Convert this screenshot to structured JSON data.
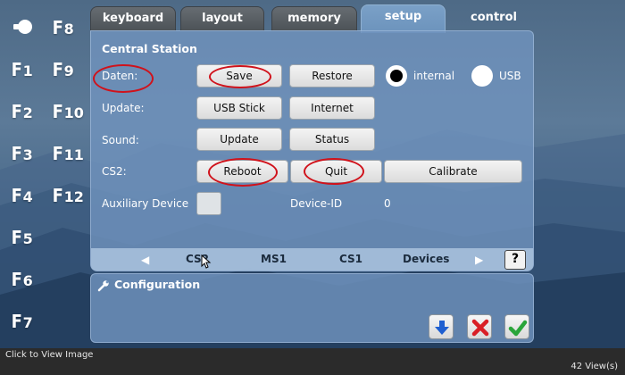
{
  "tabs": [
    {
      "label": "keyboard"
    },
    {
      "label": "layout"
    },
    {
      "label": "memory"
    },
    {
      "label": "setup",
      "active": true
    },
    {
      "label": "control"
    }
  ],
  "fkeys": [
    {
      "f": "F",
      "n": "8"
    },
    {
      "f": "F",
      "n": "1"
    },
    {
      "f": "F",
      "n": "9"
    },
    {
      "f": "F",
      "n": "2"
    },
    {
      "f": "F",
      "n": "10"
    },
    {
      "f": "F",
      "n": "3"
    },
    {
      "f": "F",
      "n": "11"
    },
    {
      "f": "F",
      "n": "4"
    },
    {
      "f": "F",
      "n": "12"
    },
    {
      "f": "F",
      "n": "5"
    },
    {
      "f": "F",
      "n": "6"
    },
    {
      "f": "F",
      "n": "7"
    }
  ],
  "panel": {
    "title": "Central Station",
    "rows": {
      "daten": {
        "label": "Daten:",
        "save": "Save",
        "restore": "Restore"
      },
      "update": {
        "label": "Update:",
        "usb_stick": "USB Stick",
        "internet": "Internet"
      },
      "sound": {
        "label": "Sound:",
        "update": "Update",
        "status": "Status"
      },
      "cs2": {
        "label": "CS2:",
        "reboot": "Reboot",
        "quit": "Quit",
        "calibrate": "Calibrate"
      },
      "aux": {
        "label": "Auxiliary Device",
        "device_id_label": "Device-ID",
        "device_id_value": "0"
      }
    },
    "storage": {
      "internal": "internal",
      "usb": "USB",
      "selected": "internal"
    }
  },
  "subtabs": {
    "items": [
      "CS2",
      "MS1",
      "CS1",
      "Devices"
    ],
    "help": "?"
  },
  "config": {
    "title": "Configuration"
  },
  "status": {
    "left": "Click to View Image",
    "right": "42 View(s)"
  },
  "colors": {
    "highlight_ring": "#d0121b",
    "ok": "#2aa53a",
    "cancel": "#d91f26",
    "down": "#1f5fd0"
  },
  "icons": [
    "lightbulb-icon",
    "wrench-icon",
    "arrow-down-icon",
    "close-icon",
    "checkmark-icon",
    "chevron-left-icon",
    "chevron-right-icon",
    "mouse-cursor-icon"
  ]
}
